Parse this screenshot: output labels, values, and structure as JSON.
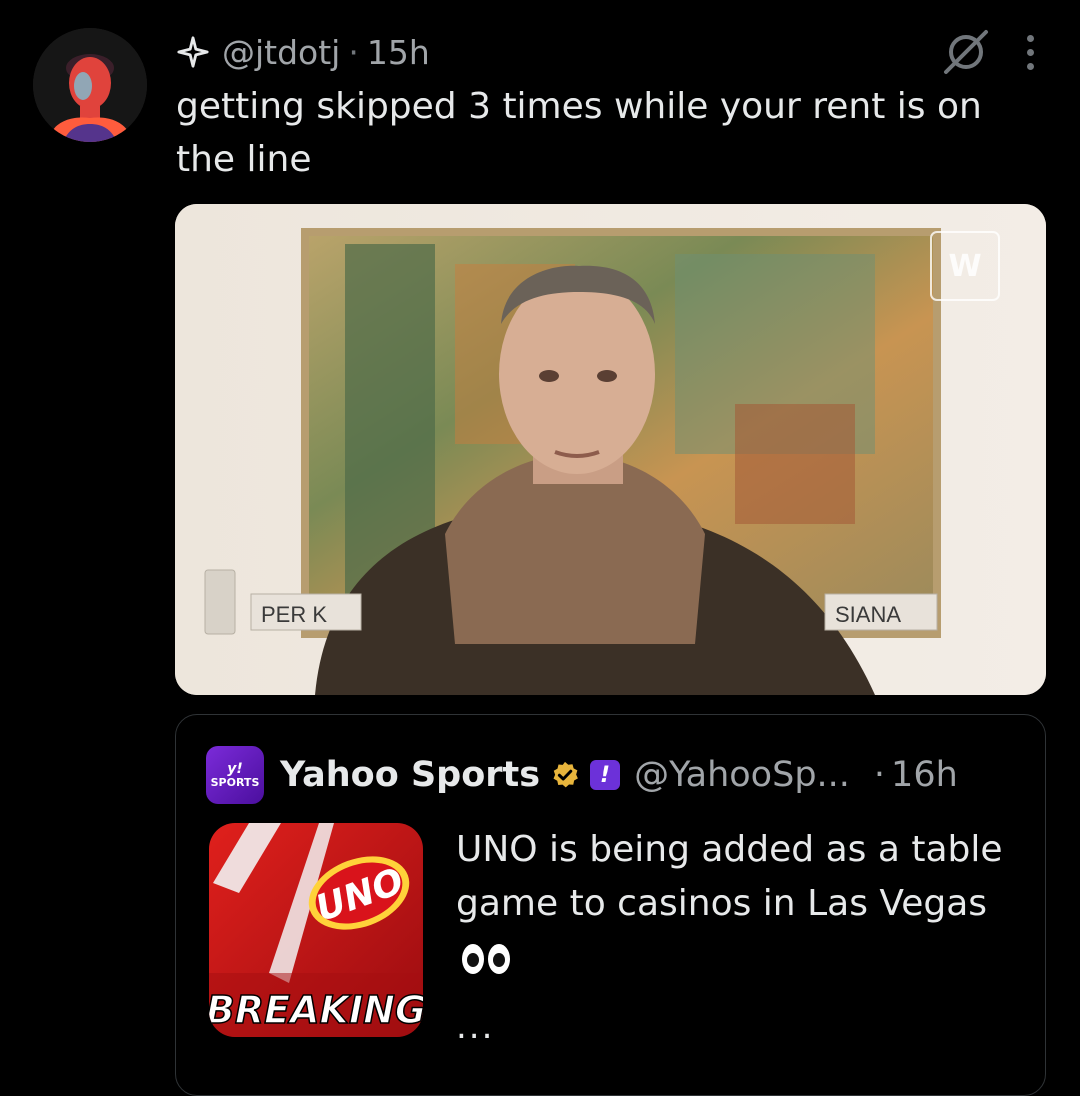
{
  "tweet": {
    "handle": "@jtdotj",
    "separator": "·",
    "time": "15h",
    "text": "getting skipped 3 times while your rent is on the line"
  },
  "media": {
    "sign_left": "PER K",
    "sign_right": "SIANA",
    "watermark": "W"
  },
  "quoted": {
    "logo_top": "y!",
    "logo_bottom": "SPORTS",
    "name": "Yahoo Sports",
    "handle": "@YahooSp...",
    "separator": "·",
    "time": "16h",
    "text": "UNO is being added as a table game to casinos in Las Vegas",
    "more": "...",
    "thumb_brand": "UNO",
    "thumb_caption": "BREAKING"
  },
  "colors": {
    "background": "#000000",
    "text": "#e7e9ea",
    "secondary": "#71767b",
    "verified_gold": "#e8b53c",
    "affiliate_purple": "#6c31d9"
  },
  "icons": [
    "avatar",
    "sparkle-icon",
    "grok-icon",
    "more-icon",
    "verified-badge-icon",
    "affiliate-badge-icon",
    "eyes-emoji"
  ]
}
